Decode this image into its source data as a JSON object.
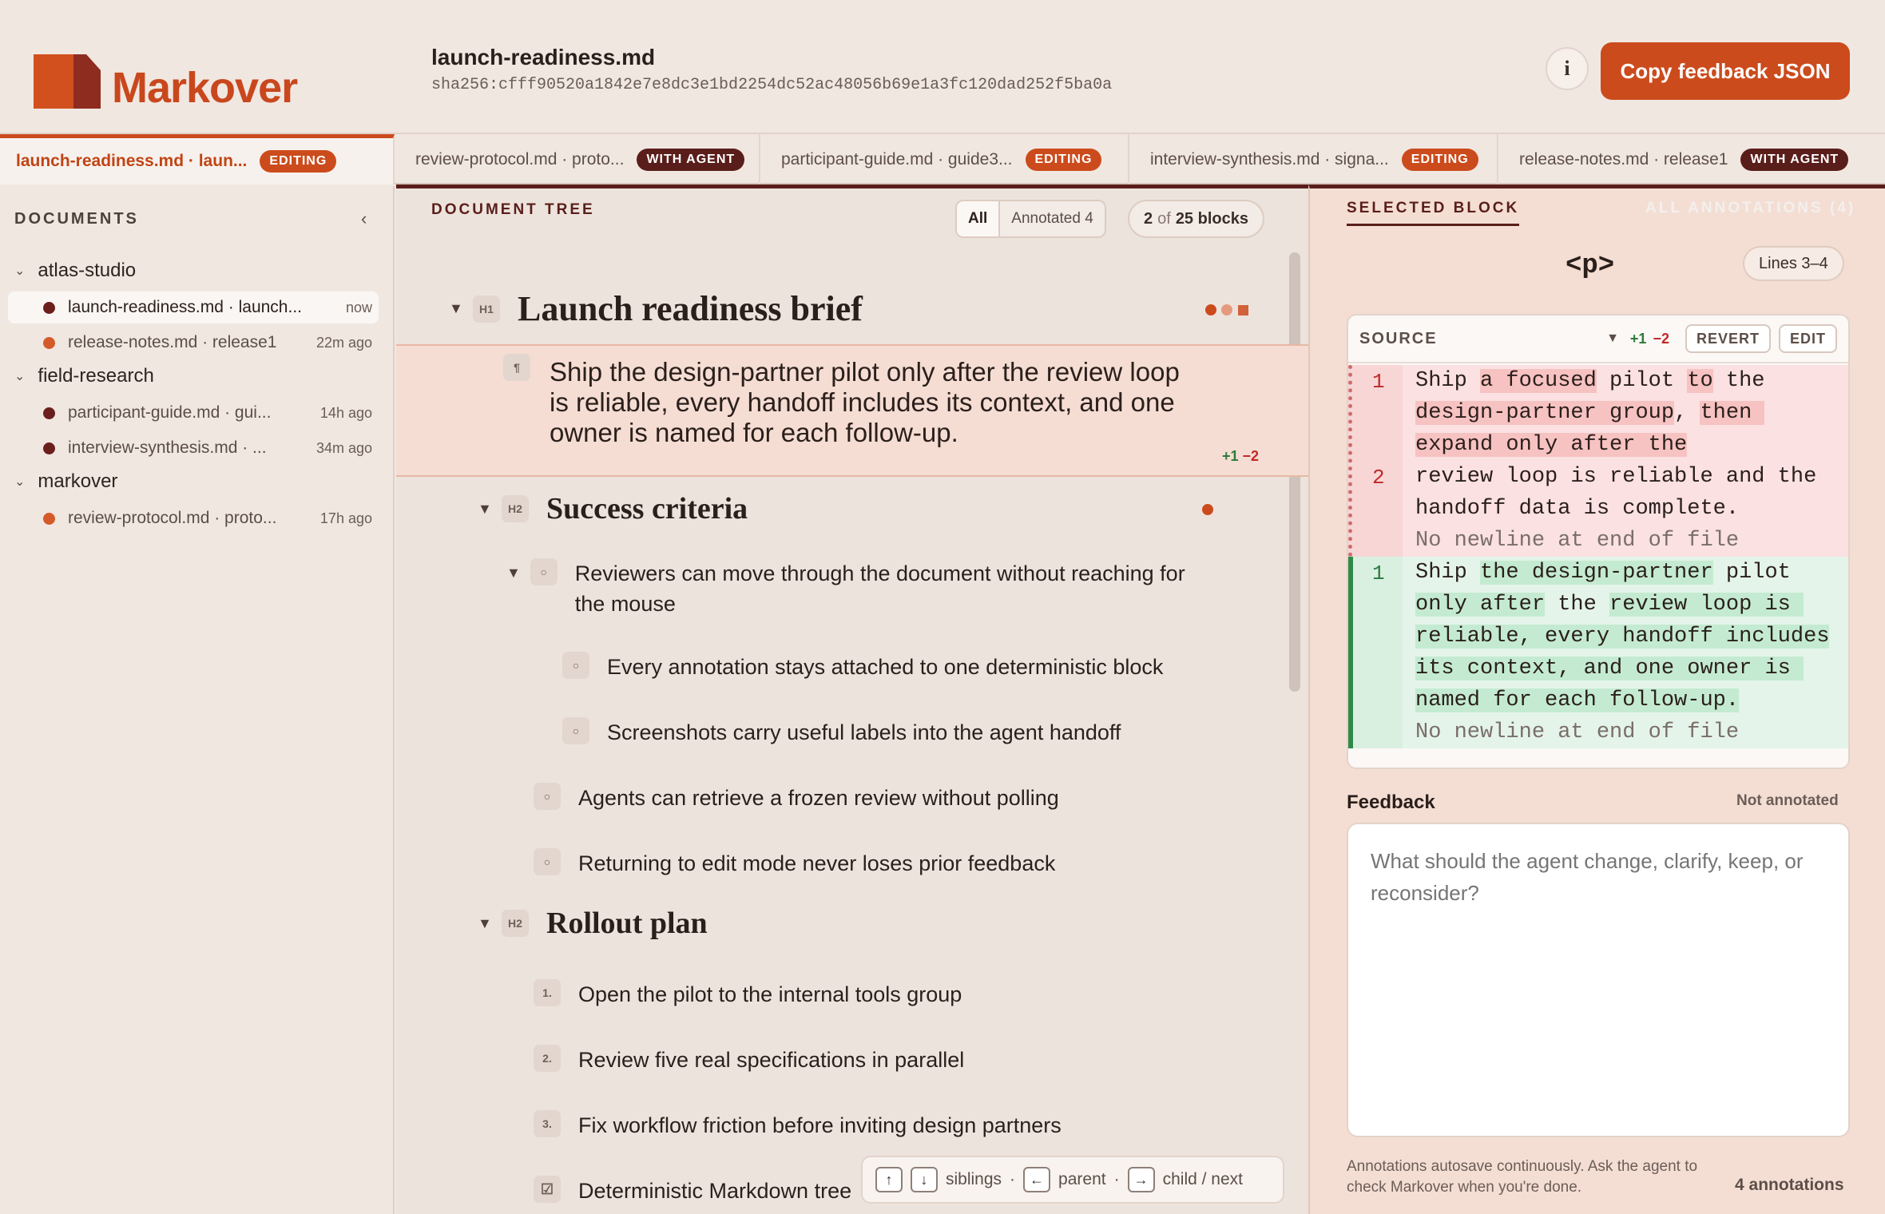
{
  "app": {
    "name": "Markover"
  },
  "header": {
    "doc_title": "launch-readiness.md",
    "doc_hash": "sha256:cfff90520a1842e7e8dc3e1bd2254dc52ac48056b69e1a3fc120dad252f5ba0a",
    "info_label": "i",
    "copy_button": "Copy feedback JSON"
  },
  "colors": {
    "accent": "#cc4b1c",
    "dark": "#5a1e1a",
    "add": "#2b7a3c",
    "del": "#c02929"
  },
  "tabs": [
    {
      "label": "launch-readiness.md · laun...",
      "badge": "EDITING",
      "badge_kind": "editing"
    },
    {
      "label": "review-protocol.md · proto...",
      "badge": "WITH AGENT",
      "badge_kind": "agent"
    },
    {
      "label": "participant-guide.md · guide3...",
      "badge": "EDITING",
      "badge_kind": "editing"
    },
    {
      "label": "interview-synthesis.md · signa...",
      "badge": "EDITING",
      "badge_kind": "editing"
    },
    {
      "label": "release-notes.md · release1",
      "badge": "WITH AGENT",
      "badge_kind": "agent"
    }
  ],
  "sidebar": {
    "heading": "DOCUMENTS",
    "collapse_icon": "chevron-left-icon",
    "groups": [
      {
        "name": "atlas-studio",
        "files": [
          {
            "name": "launch-readiness.md · launch...",
            "time": "now",
            "dot": "#6b1f1c"
          },
          {
            "name": "release-notes.md · release1",
            "time": "22m ago",
            "dot": "#d55a2a"
          }
        ]
      },
      {
        "name": "field-research",
        "files": [
          {
            "name": "participant-guide.md · gui...",
            "time": "14h ago",
            "dot": "#6b1f1c"
          },
          {
            "name": "interview-synthesis.md · ...",
            "time": "34m ago",
            "dot": "#6b1f1c"
          }
        ]
      },
      {
        "name": "markover",
        "files": [
          {
            "name": "review-protocol.md · proto...",
            "time": "17h ago",
            "dot": "#d55a2a"
          }
        ]
      }
    ]
  },
  "tree": {
    "label": "DOCUMENT TREE",
    "filter_all": "All",
    "filter_annotated": "Annotated 4",
    "count_current": "2",
    "count_of": "of",
    "count_total": "25 blocks",
    "h1_tag": "H1",
    "h1_text": "Launch readiness brief",
    "para_tag": "¶",
    "para_text": "Ship the design-partner pilot only after the review loop is reliable, every handoff includes its context, and one owner is named for each follow-up.",
    "para_add": "+1",
    "para_del": "−2",
    "h2_tag": "H2",
    "success": "Success criteria",
    "bullet_tag": "○",
    "bullets": [
      "Reviewers can move through the document without reaching for the mouse",
      "Every annotation stays attached to one deterministic block",
      "Screenshots carry useful labels into the agent handoff",
      "Agents can retrieve a frozen review without polling",
      "Returning to edit mode never loses prior feedback"
    ],
    "rollout": "Rollout plan",
    "steps": [
      {
        "tag": "1.",
        "text": "Open the pilot to the internal tools group"
      },
      {
        "tag": "2.",
        "text": "Review five real specifications in parallel"
      },
      {
        "tag": "3.",
        "text": "Fix workflow friction before inviting design partners"
      }
    ],
    "last_tag": "☑",
    "last_text": "Deterministic Markdown tree",
    "kbd": {
      "siblings": "siblings",
      "parent": "parent",
      "child": "child / next",
      "sep": "·"
    }
  },
  "panel": {
    "tab_selected": "SELECTED BLOCK",
    "tab_all": "ALL ANNOTATIONS (4)",
    "block_tag": "<p>",
    "lines": "Lines 3–4",
    "source_title": "SOURCE",
    "add": "+1",
    "del": "−2",
    "revert": "REVERT",
    "edit": "EDIT",
    "del_line_1": "1",
    "del_line_2": "2",
    "add_line_1": "1",
    "no_newline": "No newline at end of file",
    "feedback_label": "Feedback",
    "feedback_state": "Not annotated",
    "feedback_placeholder": "What should the agent change, clarify, keep, or reconsider?",
    "note": "Annotations autosave continuously. Ask the agent to check Markover when you're done.",
    "count": "4 annotations"
  }
}
